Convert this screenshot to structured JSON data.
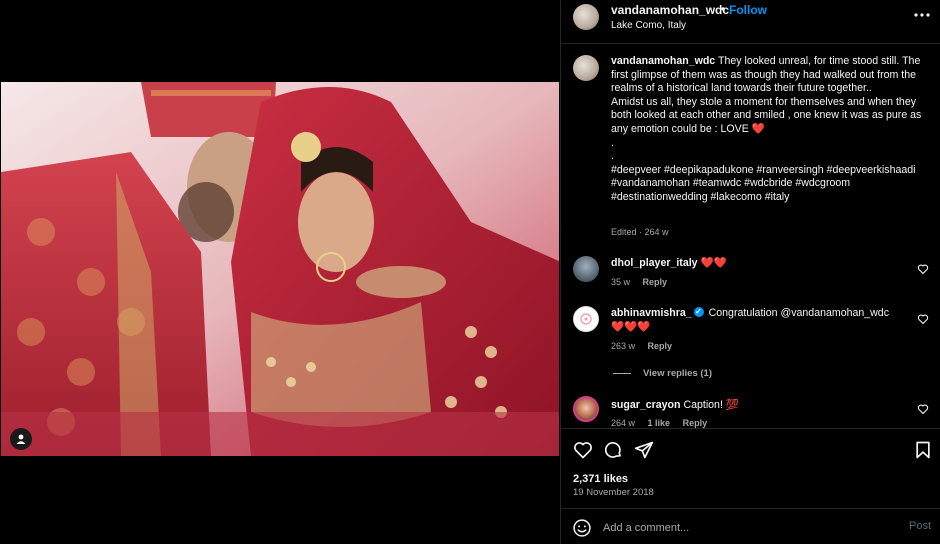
{
  "post": {
    "username": "vandanamohan_wdc",
    "follow_label": "Follow",
    "separator": "•",
    "location": "Lake Como, Italy",
    "caption": {
      "username": "vandanamohan_wdc",
      "lines": [
        "They looked unreal, for time stood still. The first glimpse of them was as though they had walked out from the realms of a historical land towards their future together..",
        "Amidst us all, they stole a moment for themselves and when they both looked at each other and smiled , one knew it was as pure as any emotion could be : LOVE ❤️",
        ".",
        ".",
        "#deepveer #deepikapadukone #ranveersingh #deepveerkishaadi #vandanamohan #teamwdc #wdcbride #wdcgroom #destinationwedding #lakecomo #italy"
      ],
      "meta": "Edited · 264 w"
    }
  },
  "comments": [
    {
      "username": "dhol_player_italy",
      "text": "❤️❤️",
      "time": "35 w",
      "reply": "Reply"
    },
    {
      "username": "abhinavmishra_",
      "text": "Congratulation @vandanamohan_wdc ❤️❤️❤️",
      "time": "263 w",
      "reply": "Reply",
      "verified": true
    },
    {
      "username": "sugar_crayon",
      "text": "Caption! 💯",
      "time": "264 w",
      "likes": "1 like",
      "reply": "Reply"
    }
  ],
  "view_replies": "View replies (1)",
  "likes": "2,371 likes",
  "date": "19 November 2018",
  "add_comment": {
    "placeholder": "Add a comment...",
    "post_label": "Post"
  },
  "icons": {
    "heart": "heart-icon",
    "comment": "comment-icon",
    "share": "share-icon",
    "save": "bookmark-icon",
    "emoji": "emoji-icon",
    "more": "more-options-icon",
    "tag": "tagged-user-icon"
  },
  "colors": {
    "accent": "#0095f6",
    "background": "#000000",
    "secondary_text": "#a8a8a8"
  }
}
